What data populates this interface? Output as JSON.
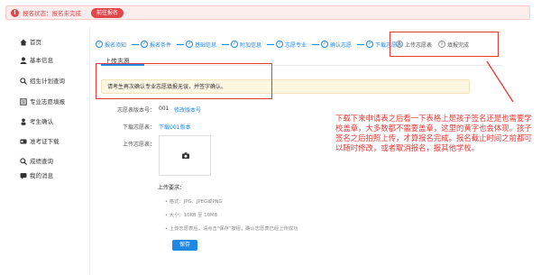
{
  "status": {
    "icon": "warning-icon",
    "text": "报名状态：报名未完成",
    "button_label": "前往报名"
  },
  "sidebar": {
    "items": [
      {
        "label": "首页",
        "icon": "home-icon"
      },
      {
        "label": "基本信息",
        "icon": "user-icon"
      },
      {
        "label": "招生计划查询",
        "icon": "search-icon"
      },
      {
        "label": "专业志愿填报",
        "icon": "form-icon"
      },
      {
        "label": "考生确认",
        "icon": "person-icon"
      },
      {
        "label": "准考证下载",
        "icon": "card-icon"
      },
      {
        "label": "成绩查询",
        "icon": "magnifier-icon"
      },
      {
        "label": "我的消息",
        "icon": "message-icon"
      }
    ]
  },
  "steps": [
    {
      "label": "报名须知",
      "done": true
    },
    {
      "label": "报名条件",
      "done": true
    },
    {
      "label": "基础信息",
      "done": true
    },
    {
      "label": "附加信息",
      "done": true
    },
    {
      "label": "志愿专业",
      "done": true
    },
    {
      "label": "确认志愿",
      "done": true
    },
    {
      "label": "下载志愿表",
      "done": true
    },
    {
      "label": "上传志愿表",
      "done": false,
      "num": "8"
    },
    {
      "label": "填报完成",
      "done": false,
      "num": "9"
    }
  ],
  "content": {
    "section_title": "上传志愿",
    "notice": "请考生再次确认专业志愿填报无误，并签字确认。",
    "version_label": "志愿表版本号：",
    "version_value": "001",
    "version_link": "修改版本号",
    "download_label": "下载志愿表：",
    "download_link": "下载001版本",
    "upload_label": "上传志愿表：",
    "requirements_title": "上传要求：",
    "requirements": [
      "• 格式：JPG、JPEG或PNG",
      "• 大小：10KB 至 10MB",
      "• 上传志愿表后，请点击\"保存\"按钮，确认志愿表已经上传成功"
    ],
    "save_label": "保存"
  },
  "annotation": "下载下来申请表之后看一下表格上是孩子签名还是也需要学校盖章，大多数都不需要盖章，这里的黄字也会体现。孩子签名之后拍照上传，才算报名完成。报名截止时间之前都可以随时修改，或者取消报名，报其他学校。",
  "colors": {
    "accent": "#1e88e5",
    "alert": "#e0474c",
    "annotation": "#e53935",
    "notice_bg": "#fdf6e3"
  }
}
